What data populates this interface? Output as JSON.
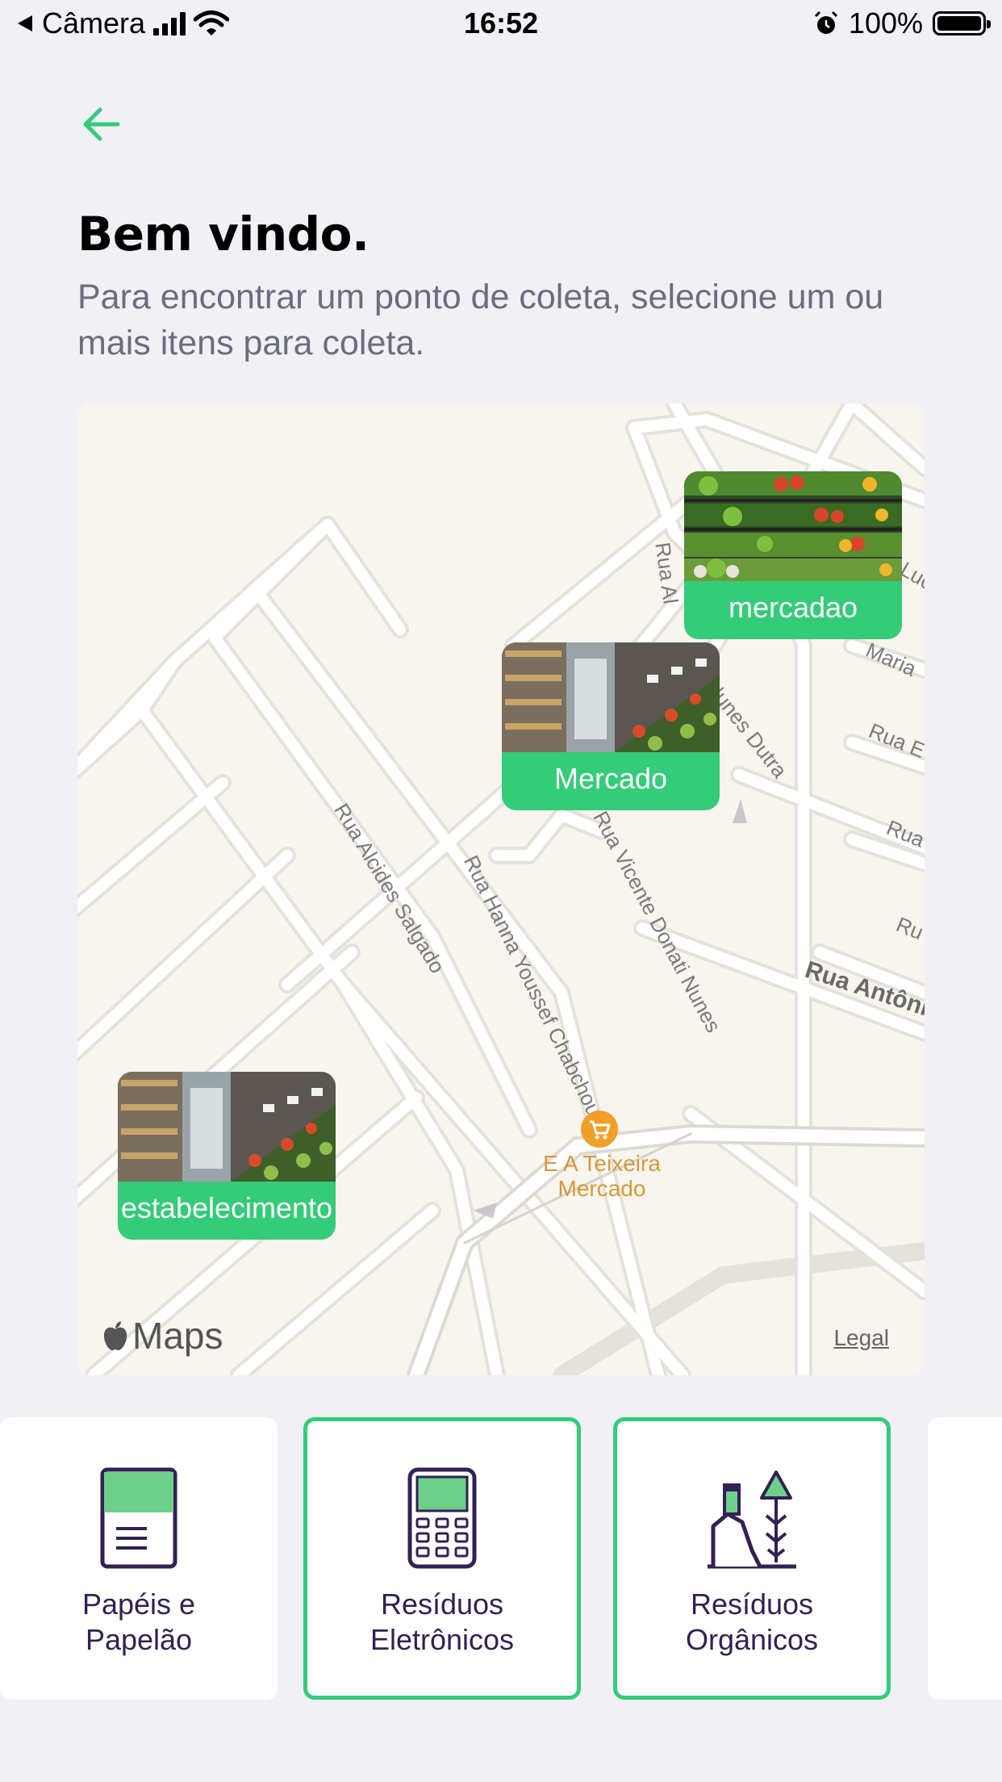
{
  "status_bar": {
    "back_app": "Câmera",
    "time": "16:52",
    "battery": "100%"
  },
  "header": {
    "title": "Bem vindo.",
    "subtitle": "Para encontrar um ponto de coleta, selecione um ou mais itens para coleta."
  },
  "map": {
    "streets": {
      "s1": "Rua Alcides Salgado",
      "s2": "Rua Hanna Youssef Chabchoul",
      "s3": "Rua Vicente Donati Nunes",
      "s4": "Nunes Dutra",
      "s5": "Rua Antôni",
      "s6": "Rua Al",
      "s7": "Rua E",
      "s8": "Rua",
      "s9": "Ru",
      "s10": "Maria",
      "s11": "Luc"
    },
    "poi": {
      "name_line1": "E A Teixeira",
      "name_line2": "Mercado"
    },
    "attribution": "Maps",
    "legal": "Legal",
    "markers": [
      {
        "label": "mercadao"
      },
      {
        "label": "Mercado"
      },
      {
        "label": "estabelecimento"
      }
    ]
  },
  "items": [
    {
      "label_line1": "Papéis e",
      "label_line2": "Papelão",
      "icon": "paper-icon",
      "selected": false
    },
    {
      "label_line1": "Resíduos",
      "label_line2": "Eletrônicos",
      "icon": "electronics-icon",
      "selected": true
    },
    {
      "label_line1": "Resíduos",
      "label_line2": "Orgânicos",
      "icon": "organic-icon",
      "selected": true
    }
  ],
  "colors": {
    "accent": "#34cb79",
    "text_primary": "#322153",
    "text_secondary": "#6c6c80",
    "background": "#f0f0f5"
  }
}
